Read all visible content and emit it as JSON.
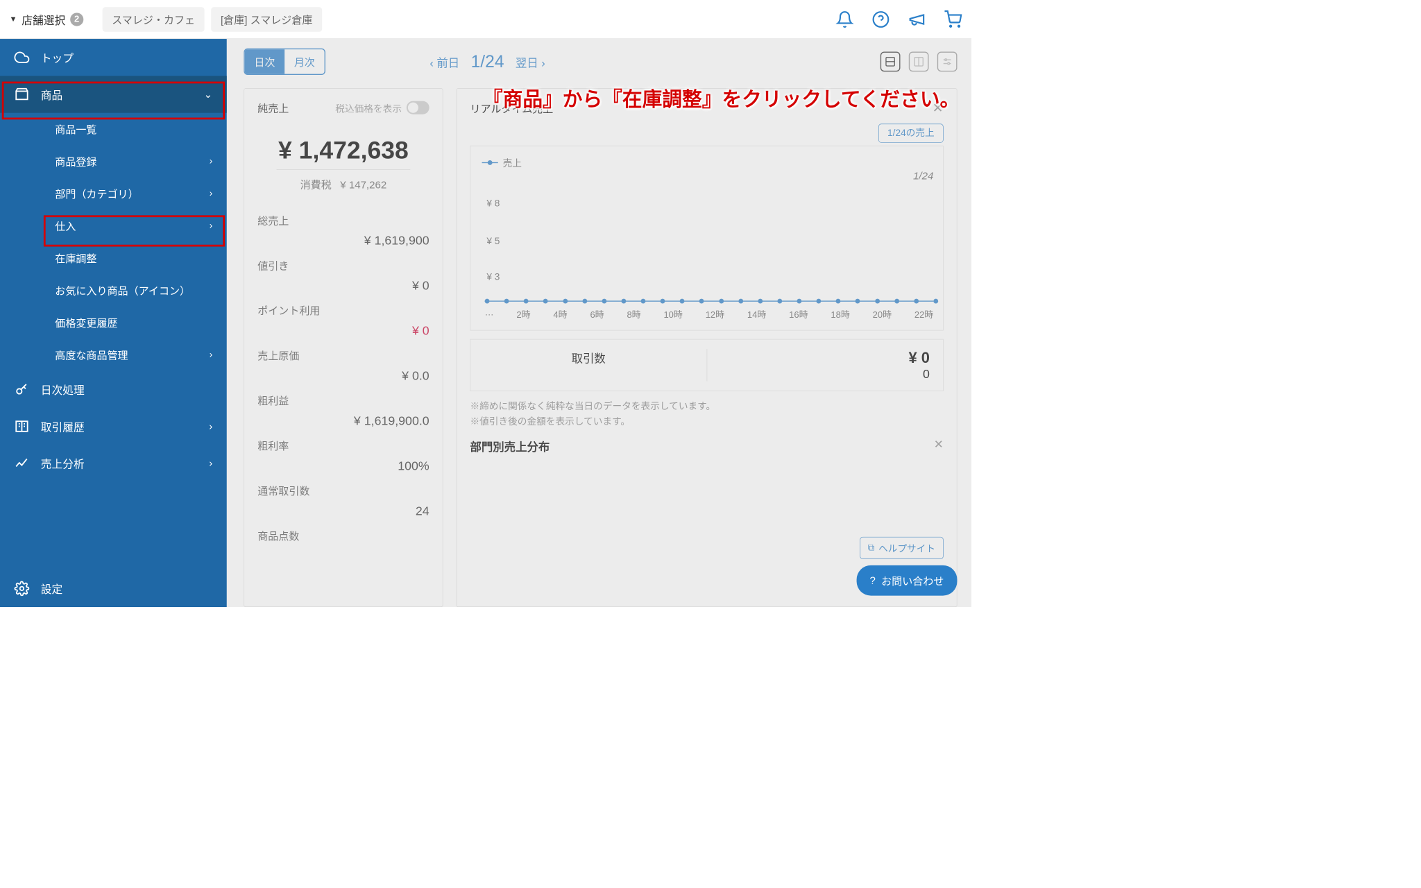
{
  "topbar": {
    "store_select": "店舗選択",
    "store_count": "2",
    "tabs": [
      "スマレジ・カフェ",
      "[倉庫] スマレジ倉庫"
    ]
  },
  "sidebar": {
    "top": "トップ",
    "product": "商品",
    "sub": {
      "list": "商品一覧",
      "register": "商品登録",
      "category": "部門（カテゴリ）",
      "purchase": "仕入",
      "stock_adjust": "在庫調整",
      "favorite": "お気に入り商品（アイコン）",
      "price_history": "価格変更履歴",
      "advanced": "高度な商品管理"
    },
    "daily": "日次処理",
    "trans": "取引履歴",
    "analysis": "売上分析",
    "settings": "設定"
  },
  "annotation": "『商品』から『在庫調整』をクリックしてください。",
  "header": {
    "seg_daily": "日次",
    "seg_monthly": "月次",
    "prev": "前日",
    "date": "1/24",
    "next": "翌日"
  },
  "net_sales": {
    "title": "純売上",
    "tax_toggle": "税込価格を表示",
    "amount": "¥ 1,472,638",
    "tax_label": "消費税",
    "tax_value": "¥ 147,262",
    "stats": [
      {
        "label": "総売上",
        "value": "¥ 1,619,900"
      },
      {
        "label": "値引き",
        "value": "¥ 0"
      },
      {
        "label": "ポイント利用",
        "value": "¥ 0",
        "red": true
      },
      {
        "label": "売上原価",
        "value": "¥ 0.0"
      },
      {
        "label": "粗利益",
        "value": "¥ 1,619,900.0"
      },
      {
        "label": "粗利率",
        "value": "100%"
      },
      {
        "label": "通常取引数",
        "value": "24"
      },
      {
        "label": "商品点数",
        "value": ""
      }
    ]
  },
  "realtime": {
    "title": "リアルタイム売上",
    "btn": "1/24の売上",
    "legend": "売上",
    "period": "1/24",
    "trans_count_label": "取引数",
    "trans_count": "0",
    "amount": "¥ 0",
    "notes": [
      "※締めに関係なく純粋な当日のデータを表示しています。",
      "※値引き後の金額を表示しています。"
    ],
    "help": "ヘルプサイト",
    "section_hdr": "部門別売上分布"
  },
  "chart_data": {
    "type": "line",
    "title": "売上",
    "xlabel": "",
    "ylabel": "",
    "y_ticks": [
      "¥ 8",
      "¥ 5",
      "¥ 3"
    ],
    "x_ticks": [
      "…",
      "2時",
      "4時",
      "6時",
      "8時",
      "10時",
      "12時",
      "14時",
      "16時",
      "18時",
      "20時",
      "22時"
    ],
    "series": [
      {
        "name": "売上",
        "values": [
          0,
          0,
          0,
          0,
          0,
          0,
          0,
          0,
          0,
          0,
          0,
          0,
          0,
          0,
          0,
          0,
          0,
          0,
          0,
          0,
          0,
          0,
          0,
          0
        ]
      }
    ],
    "period_label": "1/24"
  },
  "contact": "お問い合わせ"
}
